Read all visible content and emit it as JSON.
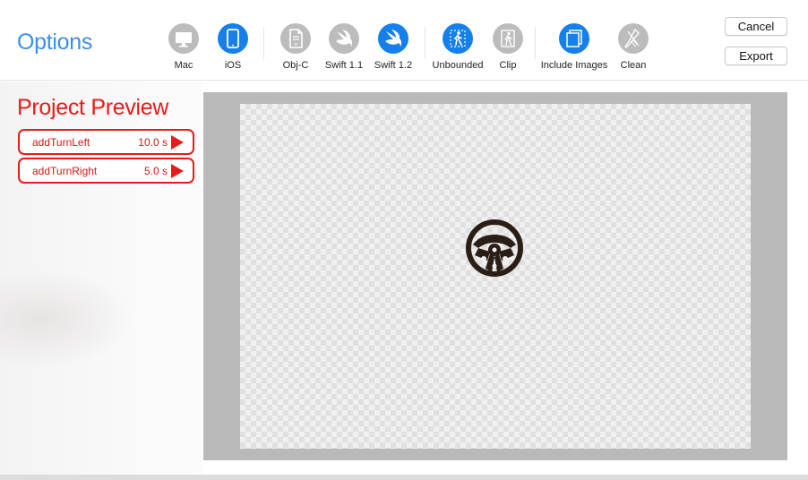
{
  "header": {
    "title": "Options",
    "options": [
      {
        "id": "mac",
        "label": "Mac",
        "active": false,
        "icon": "monitor-icon"
      },
      {
        "id": "ios",
        "label": "iOS",
        "active": true,
        "icon": "tablet-icon"
      },
      {
        "id": "objc",
        "label": "Obj-C",
        "active": false,
        "icon": "source-file-icon"
      },
      {
        "id": "swift11",
        "label": "Swift 1.1",
        "active": false,
        "icon": "swift-icon"
      },
      {
        "id": "swift12",
        "label": "Swift 1.2",
        "active": true,
        "icon": "swift-icon"
      },
      {
        "id": "unbounded",
        "label": "Unbounded",
        "active": true,
        "icon": "unbounded-figure-icon"
      },
      {
        "id": "clip",
        "label": "Clip",
        "active": false,
        "icon": "clip-figure-icon"
      },
      {
        "id": "include_images",
        "label": "Include Images",
        "active": true,
        "icon": "images-stack-icon"
      },
      {
        "id": "clean",
        "label": "Clean",
        "active": false,
        "icon": "broom-icon"
      }
    ],
    "cancel_label": "Cancel",
    "export_label": "Export"
  },
  "sidebar": {
    "title": "Project Preview",
    "animations": [
      {
        "name": "addTurnLeft",
        "duration": "10.0 s"
      },
      {
        "name": "addTurnRight",
        "duration": "5.0 s"
      }
    ]
  },
  "preview": {
    "object_icon": "steering-wheel-icon"
  },
  "colors": {
    "accent_blue": "#1680ea",
    "title_blue": "#3c8ee8",
    "accent_red": "#e81a1a",
    "inactive_gray": "#bcbcbc",
    "wheel_color": "#2a1e16"
  }
}
